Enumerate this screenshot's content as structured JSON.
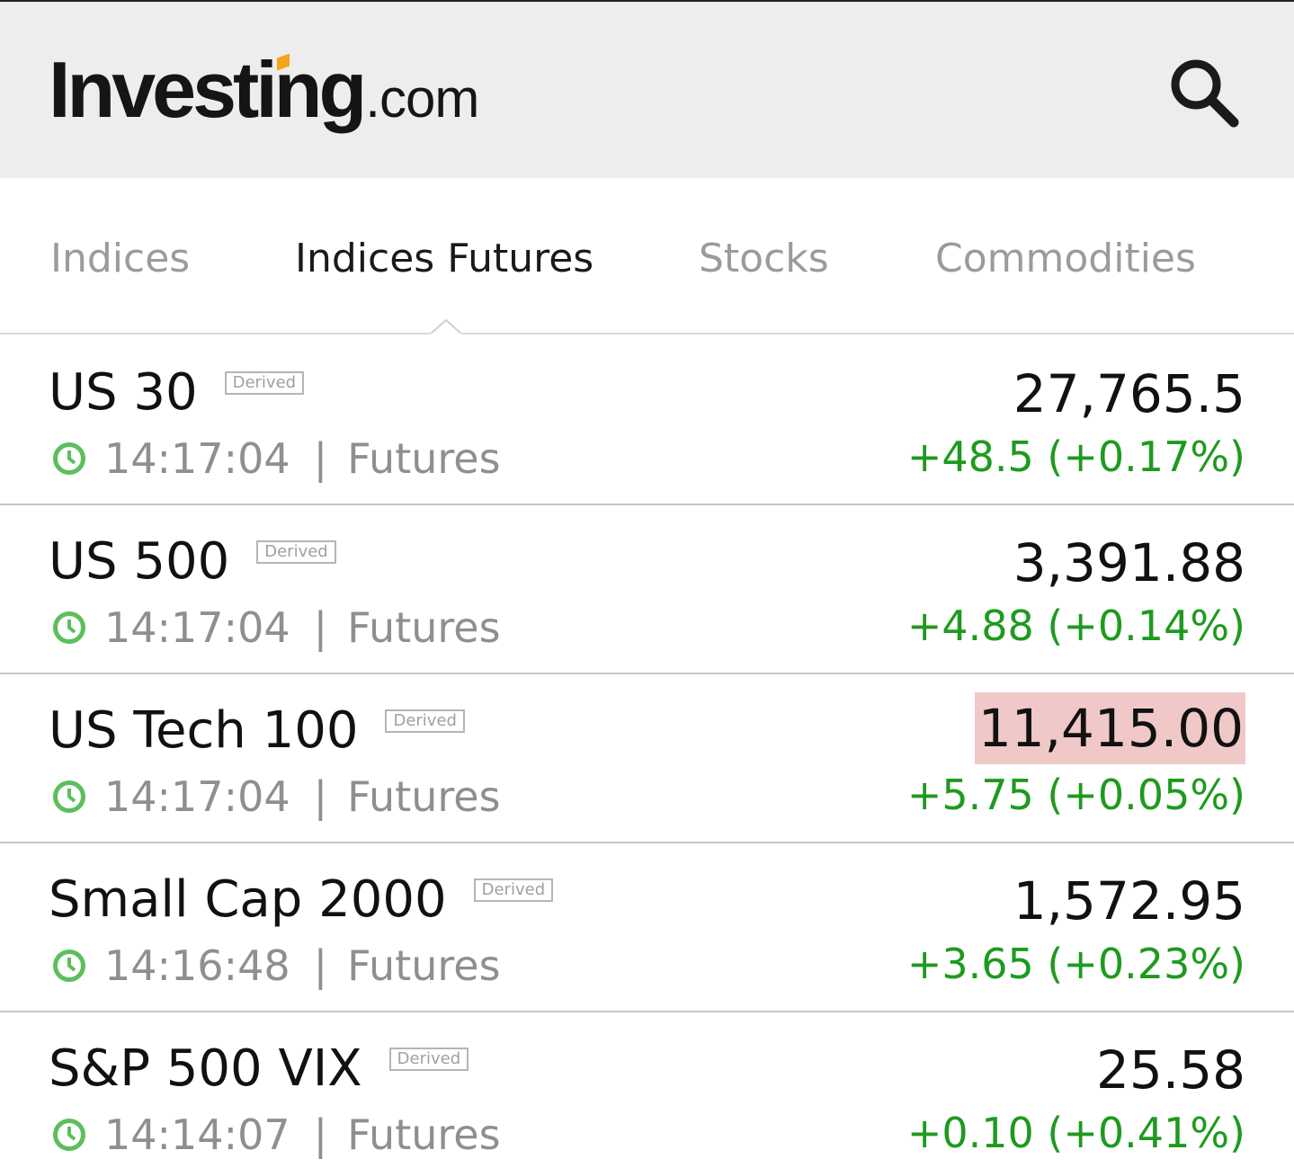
{
  "header": {
    "logo_main": "Investing",
    "logo_suffix": ".com",
    "search_icon": "search-icon",
    "accent_color": "#f4a31c"
  },
  "tabs": [
    {
      "label": "Indices",
      "active": false
    },
    {
      "label": "Indices Futures",
      "active": true
    },
    {
      "label": "Stocks",
      "active": false
    },
    {
      "label": "Commodities",
      "active": false
    }
  ],
  "instruments": [
    {
      "name": "US 30",
      "badge": "Derived",
      "time": "14:17:04",
      "separator": "|",
      "type": "Futures",
      "price": "27,765.5",
      "change": "+48.5 (+0.17%)",
      "flash": false
    },
    {
      "name": "US 500",
      "badge": "Derived",
      "time": "14:17:04",
      "separator": "|",
      "type": "Futures",
      "price": "3,391.88",
      "change": "+4.88 (+0.14%)",
      "flash": false
    },
    {
      "name": "US Tech 100",
      "badge": "Derived",
      "time": "14:17:04",
      "separator": "|",
      "type": "Futures",
      "price": "11,415.00",
      "change": "+5.75 (+0.05%)",
      "flash": true
    },
    {
      "name": "Small Cap 2000",
      "badge": "Derived",
      "time": "14:16:48",
      "separator": "|",
      "type": "Futures",
      "price": "1,572.95",
      "change": "+3.65 (+0.23%)",
      "flash": false
    },
    {
      "name": "S&P 500 VIX",
      "badge": "Derived",
      "time": "14:14:07",
      "separator": "|",
      "type": "Futures",
      "price": "25.58",
      "change": "+0.10 (+0.41%)",
      "flash": false
    }
  ],
  "colors": {
    "positive": "#1e9a1e",
    "flash_down": "#f0c8c8",
    "clock": "#5cbf5c"
  }
}
